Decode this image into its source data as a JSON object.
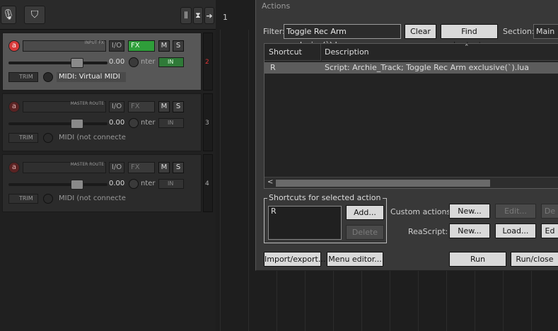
{
  "toolbar": {
    "icons": [
      "microphone-icon",
      "pin-icon",
      "mixer-icon",
      "routing-icon",
      "arrow-right-icon"
    ]
  },
  "tracks": [
    {
      "number": "2",
      "input_label": "INPUT FX",
      "io": "I/O",
      "fx": "FX",
      "mute": "M",
      "solo": "S",
      "volume": "0.00",
      "pan": "nter",
      "in": "IN",
      "trim": "TRIM",
      "midi": "MIDI: Virtual MIDI",
      "selected": true
    },
    {
      "number": "3",
      "input_label": "MASTER ROUTE",
      "io": "I/O",
      "fx": "FX",
      "mute": "M",
      "solo": "S",
      "volume": "0.00",
      "pan": "nter",
      "in": "IN",
      "trim": "TRIM",
      "midi": "MIDI (not connecte",
      "selected": false
    },
    {
      "number": "4",
      "input_label": "MASTER ROUTE",
      "io": "I/O",
      "fx": "FX",
      "mute": "M",
      "solo": "S",
      "volume": "0.00",
      "pan": "nter",
      "in": "IN",
      "trim": "TRIM",
      "midi": "MIDI (not connecte",
      "selected": false
    }
  ],
  "arrange": {
    "ruler_label": "1"
  },
  "actions": {
    "title": "Actions",
    "filter_label": "Filter:",
    "filter_value": "Toggle Rec Arm exclusive(`).lua",
    "clear_button": "Clear",
    "find_shortcut_button": "Find shortcut...",
    "section_label": "Section:",
    "section_value": "Main",
    "columns": [
      "Shortcut",
      "Description"
    ],
    "rows": [
      {
        "shortcut": "R",
        "description": "Script: Archie_Track;  Toggle Rec Arm exclusive(`).lua"
      }
    ],
    "shortcuts_group_title": "Shortcuts for selected action",
    "shortcut_entry": "R",
    "add_button": "Add...",
    "delete_button": "Delete",
    "custom_actions_label": "Custom actions:",
    "custom_new_button": "New...",
    "custom_edit_button": "Edit...",
    "custom_delete_button": "De",
    "reascript_label": "ReaScript:",
    "reascript_new_button": "New...",
    "reascript_load_button": "Load...",
    "reascript_edit_button": "Ed",
    "import_export_button": "Import/export...",
    "menu_editor_button": "Menu editor...",
    "run_button": "Run",
    "run_close_button": "Run/close"
  }
}
